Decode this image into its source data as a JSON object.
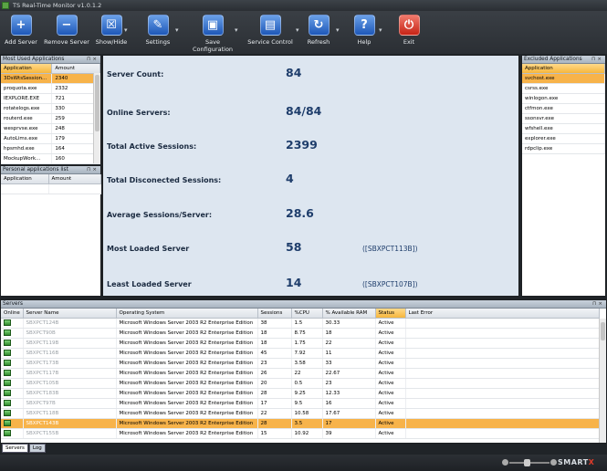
{
  "app": {
    "title": "TS Real-Time Monitor v1.0.1.2"
  },
  "toolbar": [
    {
      "label": "Add Server",
      "icon": "plus-icon",
      "color": "blue",
      "glyph": "+"
    },
    {
      "label": "Remove Server",
      "icon": "minus-icon",
      "color": "blue",
      "glyph": "−"
    },
    {
      "label": "Show/Hide",
      "icon": "window-icon",
      "color": "blue",
      "glyph": "☒"
    },
    {
      "label": "Settings",
      "icon": "wrench-icon",
      "color": "blue",
      "glyph": "✎"
    },
    {
      "label": "Save Configuration",
      "icon": "disk-icon",
      "color": "blue",
      "glyph": "▣"
    },
    {
      "label": "Service Control",
      "icon": "server-icon",
      "color": "blue",
      "glyph": "▤"
    },
    {
      "label": "Refresh",
      "icon": "refresh-icon",
      "color": "blue",
      "glyph": "↻"
    },
    {
      "label": "Help",
      "icon": "help-icon",
      "color": "blue",
      "glyph": "?"
    },
    {
      "label": "Exit",
      "icon": "power-icon",
      "color": "red",
      "glyph": "⏻"
    }
  ],
  "most_used": {
    "title": "Most Used Applications",
    "headers": [
      "Application",
      "Amount"
    ],
    "rows": [
      [
        "3DsWtsSession...",
        "2340"
      ],
      [
        "proquota.exe",
        "2332"
      ],
      [
        "IEXPLORE.EXE",
        "721"
      ],
      [
        "rotatelogs.exe",
        "330"
      ],
      [
        "routerd.exe",
        "259"
      ],
      [
        "wesprvse.exe",
        "248"
      ],
      [
        "AutoLims.exe",
        "179"
      ],
      [
        "hpsmhd.exe",
        "164"
      ],
      [
        "MockupWork...",
        "160"
      ]
    ]
  },
  "personal": {
    "title": "Personal applications list",
    "headers": [
      "Application",
      "Amount"
    ]
  },
  "stats": {
    "server_count_label": "Server Count:",
    "server_count": "84",
    "online_label": "Online Servers:",
    "online": "84/84",
    "active_label": "Total Active Sessions:",
    "active": "2399",
    "disconnected_label": "Total Disconected Sessions:",
    "disconnected": "4",
    "avg_label": "Average Sessions/Server:",
    "avg": "28.6",
    "most_label": "Most Loaded Server",
    "most": "58",
    "most_server": "([SBXPCT113B])",
    "least_label": "Least Loaded Server",
    "least": "14",
    "least_server": "([SBXPCT107B])"
  },
  "excluded": {
    "title": "Excluded Applications",
    "header": "Application",
    "items": [
      "svchost.exe",
      "csrss.exe",
      "winlogon.exe",
      "ctfmon.exe",
      "ssonsvr.exe",
      "wfshell.exe",
      "explorer.exe",
      "rdpclip.exe"
    ]
  },
  "servers": {
    "title": "Servers",
    "headers": [
      "Online",
      "Server Name",
      "Operating System",
      "Sessions",
      "%CPU",
      "% Available RAM",
      "Status",
      "Last Error"
    ],
    "rows": [
      [
        "SBXPCT124B",
        "Microsoft Windows Server 2003 R2 Enterprise Edition",
        "38",
        "1.5",
        "30.33",
        "Active",
        ""
      ],
      [
        "SBXPCT90B",
        "Microsoft Windows Server 2003 R2 Enterprise Edition",
        "18",
        "8.75",
        "18",
        "Active",
        ""
      ],
      [
        "SBXPCT119B",
        "Microsoft Windows Server 2003 R2 Enterprise Edition",
        "18",
        "1.75",
        "22",
        "Active",
        ""
      ],
      [
        "SBXPCT116B",
        "Microsoft Windows Server 2003 R2 Enterprise Edition",
        "45",
        "7.92",
        "11",
        "Active",
        ""
      ],
      [
        "SBXPCT173B",
        "Microsoft Windows Server 2003 R2 Enterprise Edition",
        "23",
        "3.58",
        "33",
        "Active",
        ""
      ],
      [
        "SBXPCT117B",
        "Microsoft Windows Server 2003 R2 Enterprise Edition",
        "26",
        "22",
        "22.67",
        "Active",
        ""
      ],
      [
        "SBXPCT105B",
        "Microsoft Windows Server 2003 R2 Enterprise Edition",
        "20",
        "0.5",
        "23",
        "Active",
        ""
      ],
      [
        "SBXPCT183B",
        "Microsoft Windows Server 2003 R2 Enterprise Edition",
        "28",
        "9.25",
        "12.33",
        "Active",
        ""
      ],
      [
        "SBXPCT97B",
        "Microsoft Windows Server 2003 R2 Enterprise Edition",
        "17",
        "9.5",
        "16",
        "Active",
        ""
      ],
      [
        "SBXPCT118B",
        "Microsoft Windows Server 2003 R2 Enterprise Edition",
        "22",
        "10.58",
        "17.67",
        "Active",
        ""
      ],
      [
        "SBXPCT143B",
        "Microsoft Windows Server 2003 R2 Enterprise Edition",
        "28",
        "3.5",
        "17",
        "Active",
        ""
      ],
      [
        "SBXPCT155B",
        "Microsoft Windows Server 2003 R2 Enterprise Edition",
        "15",
        "10.92",
        "39",
        "Active",
        ""
      ]
    ]
  },
  "tabs": [
    "Servers",
    "Log"
  ],
  "logo": {
    "main": "SMART",
    "accent": "X"
  }
}
